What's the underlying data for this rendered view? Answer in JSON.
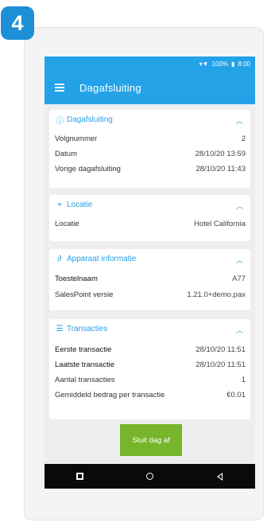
{
  "step": {
    "number": "4"
  },
  "status_bar": {
    "battery": "100%",
    "time": "8:00"
  },
  "app_bar": {
    "title": "Dagafsluiting"
  },
  "sections": {
    "dagafsluiting": {
      "title": "Dagafsluiting",
      "icon": "info-icon",
      "rows": [
        {
          "label": "Volgnummer",
          "value": "2"
        },
        {
          "label": "Datum",
          "value": "28/10/20 13:59"
        },
        {
          "label": "Vorige dagafsluiting",
          "value": "28/10/20 11:43"
        }
      ]
    },
    "locatie": {
      "title": "Locatie",
      "icon": "location-pin-icon",
      "rows": [
        {
          "label": "Locatie",
          "value": "Hotel California"
        }
      ]
    },
    "apparaat": {
      "title": "Apparaat informatie",
      "icon": "link-icon",
      "rows": [
        {
          "label": "Toestelnaam",
          "value": "A77"
        },
        {
          "label": "SalesPoint versie",
          "value": "1.21.0+demo.pax"
        }
      ]
    },
    "transacties": {
      "title": "Transacties",
      "icon": "list-icon",
      "rows": [
        {
          "label": "Eerste transactie",
          "value": "28/10/20 11:51"
        },
        {
          "label": "Laatste transactie",
          "value": "28/10/20 11:51"
        },
        {
          "label": "Aantal transacties",
          "value": "1"
        },
        {
          "label": "Gemiddeld bedrag per transactie",
          "value": "€0.01"
        }
      ]
    }
  },
  "action": {
    "close_day_label": "Sluit dag af"
  },
  "colors": {
    "accent": "#23a2e8",
    "badge": "#1c8fd6",
    "button": "#77b52b"
  }
}
